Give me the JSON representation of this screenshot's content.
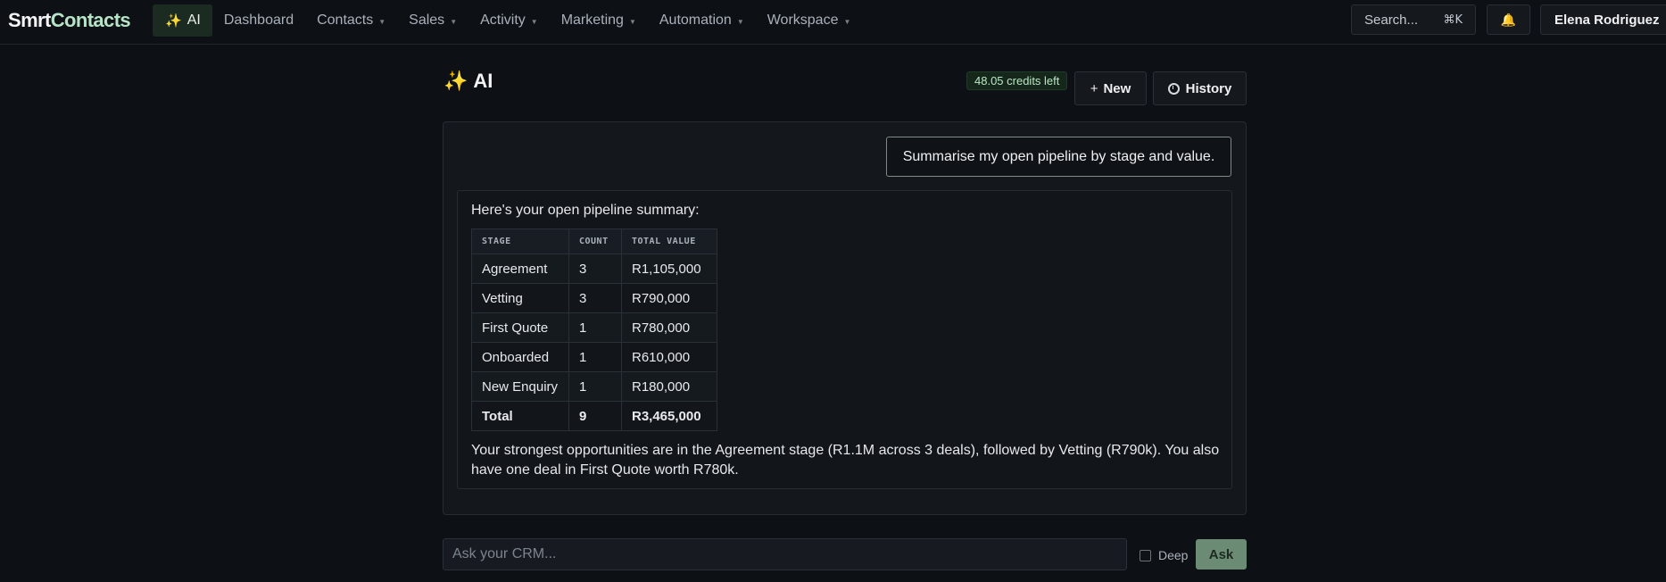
{
  "brand": {
    "part1": "Smrt",
    "part2": "Contacts"
  },
  "nav": {
    "ai_icon": "✨",
    "ai_label": "AI",
    "items": [
      {
        "label": "Dashboard",
        "has_caret": false
      },
      {
        "label": "Contacts",
        "has_caret": true
      },
      {
        "label": "Sales",
        "has_caret": true
      },
      {
        "label": "Activity",
        "has_caret": true
      },
      {
        "label": "Marketing",
        "has_caret": true
      },
      {
        "label": "Automation",
        "has_caret": true
      },
      {
        "label": "Workspace",
        "has_caret": true
      }
    ],
    "search_label": "Search...",
    "search_shortcut": "⌘K",
    "bell_icon": "🔔",
    "user_name": "Elena Rodriguez"
  },
  "header": {
    "title_icon": "✨",
    "title": "AI",
    "credits": "48.05 credits left",
    "new_icon": "+",
    "new_label": "New",
    "history_label": "History"
  },
  "chat": {
    "user_message": "Summarise my open pipeline by stage and value.",
    "ai_intro": "Here's your open pipeline summary:",
    "table": {
      "headers": [
        "STAGE",
        "COUNT",
        "TOTAL VALUE"
      ],
      "rows": [
        [
          "Agreement",
          "3",
          "R1,105,000"
        ],
        [
          "Vetting",
          "3",
          "R790,000"
        ],
        [
          "First Quote",
          "1",
          "R780,000"
        ],
        [
          "Onboarded",
          "1",
          "R610,000"
        ],
        [
          "New Enquiry",
          "1",
          "R180,000"
        ]
      ],
      "total": [
        "Total",
        "9",
        "R3,465,000"
      ]
    },
    "ai_summary": "Your strongest opportunities are in the Agreement stage (R1.1M across 3 deals), followed by Vetting (R790k). You also have one deal in First Quote worth R780k."
  },
  "composer": {
    "placeholder": "Ask your CRM...",
    "value": "",
    "deep_label": "Deep",
    "deep_checked": false,
    "ask_label": "Ask"
  },
  "colors": {
    "background": "#0d1014",
    "accent_green": "#6c8b74",
    "brand_accent": "#b7e4c7"
  }
}
